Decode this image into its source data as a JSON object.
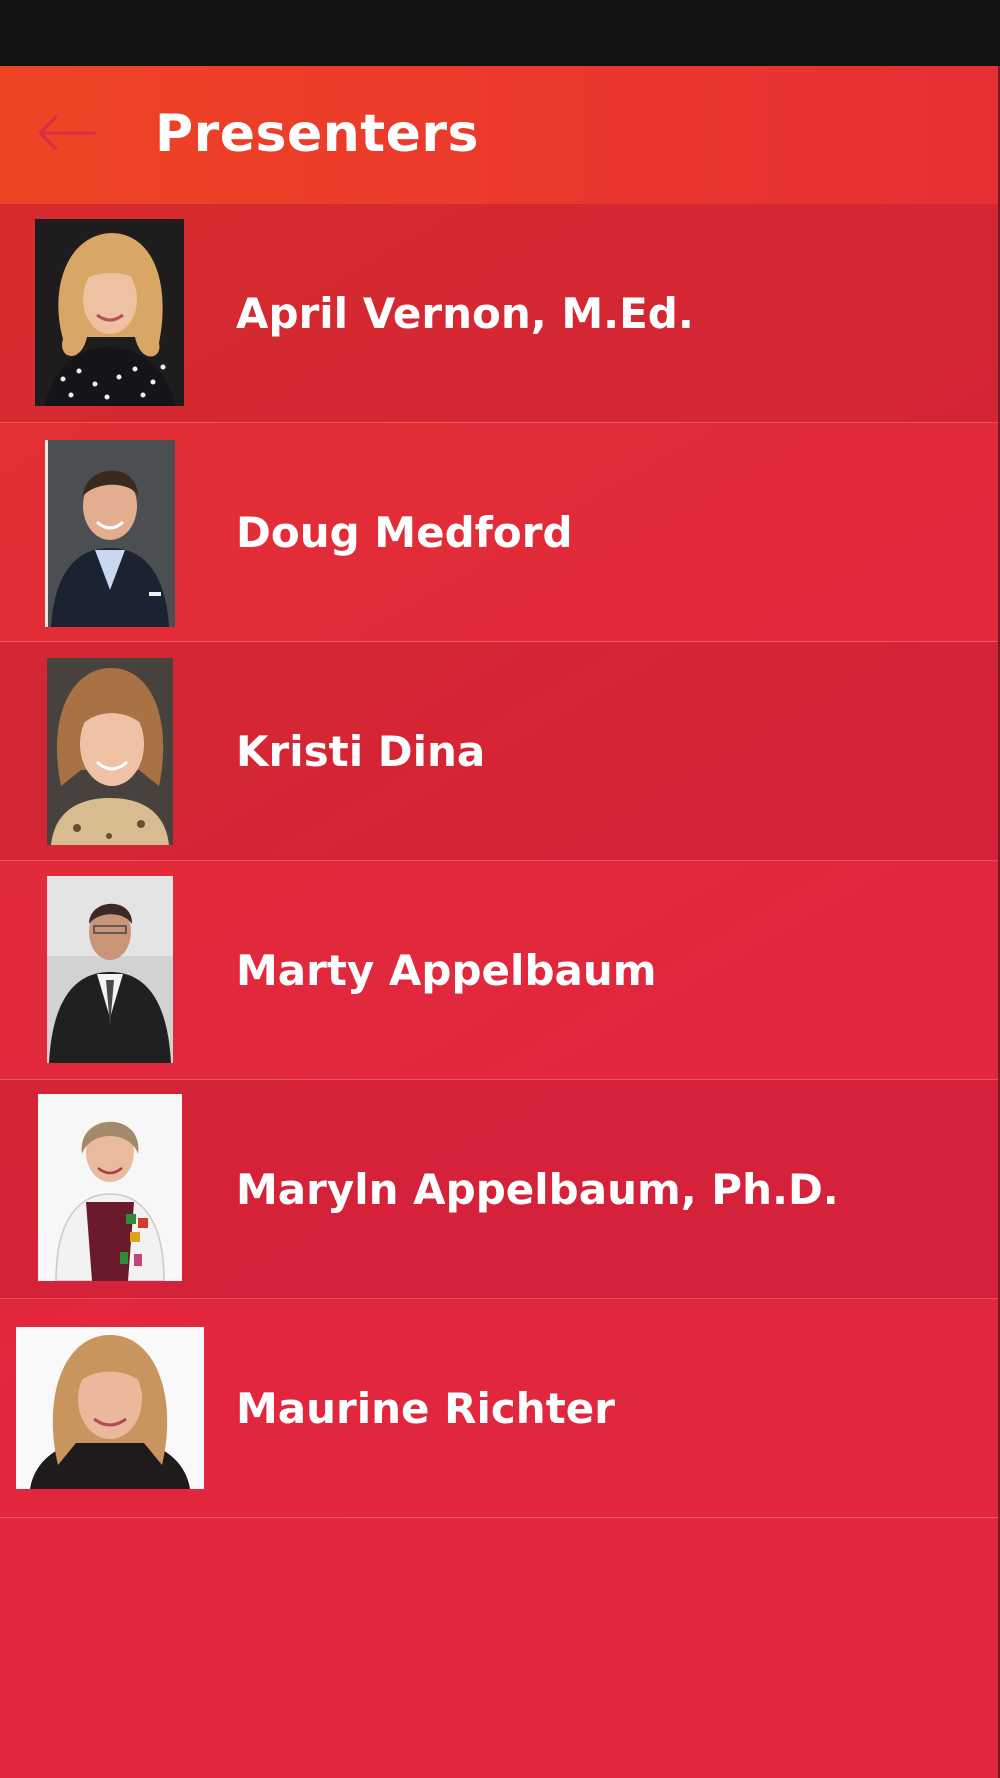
{
  "header": {
    "title": "Presenters",
    "back_icon": "arrow-left-icon"
  },
  "presenters": [
    {
      "name": "April Vernon, M.Ed."
    },
    {
      "name": "Doug Medford"
    },
    {
      "name": "Kristi Dina"
    },
    {
      "name": "Marty Appelbaum"
    },
    {
      "name": "Maryln Appelbaum, Ph.D."
    },
    {
      "name": "Maurine Richter"
    }
  ],
  "colors": {
    "app_bar": "#ec3a2b",
    "list_background": "#e2263e",
    "text": "#ffffff",
    "status_bar": "#121212"
  }
}
